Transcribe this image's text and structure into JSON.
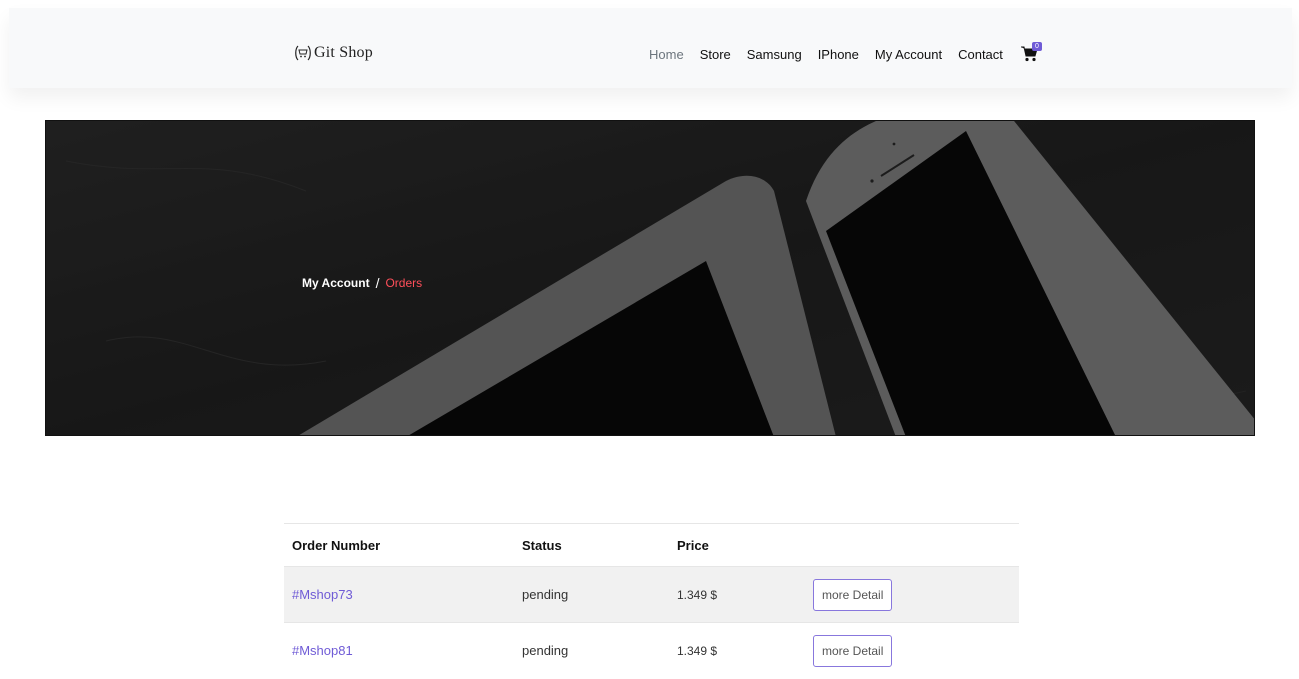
{
  "header": {
    "brand": "Git Shop",
    "nav": [
      "Home",
      "Store",
      "Samsung",
      "IPhone",
      "My Account",
      "Contact"
    ],
    "cart_count": "0"
  },
  "hero": {
    "breadcrumb_parent": "My Account",
    "breadcrumb_separator": "/",
    "breadcrumb_current": "Orders"
  },
  "orders": {
    "columns": [
      "Order Number",
      "Status",
      "Price",
      ""
    ],
    "rows": [
      {
        "order_number": "#Mshop73",
        "status": "pending",
        "price": "1.349 $",
        "action": "more Detail"
      },
      {
        "order_number": "#Mshop81",
        "status": "pending",
        "price": "1.349 $",
        "action": "more Detail"
      }
    ]
  },
  "colors": {
    "accent": "#6f5bd6",
    "breadcrumb_current": "#ff4f5a",
    "hero_bg": "#2a2a2a"
  }
}
